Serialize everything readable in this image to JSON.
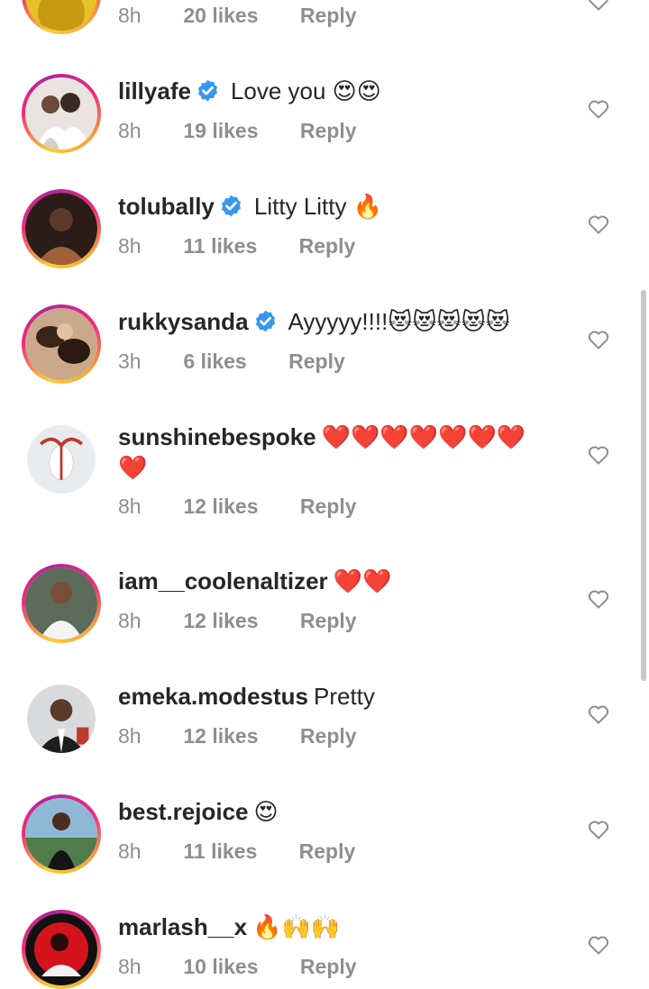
{
  "colors": {
    "text": "#262626",
    "meta": "#8e8e8e",
    "verified": "#3897f0",
    "heart_emoji": "#d62828"
  },
  "top_partial": {
    "time": "8h",
    "likes": "20 likes",
    "reply": "Reply"
  },
  "comments": [
    {
      "username": "lillyafe",
      "verified": true,
      "text": "Love you 😍😍",
      "time": "8h",
      "likes": "19 likes",
      "reply": "Reply"
    },
    {
      "username": "tolubally",
      "verified": true,
      "text": "Litty Litty 🔥",
      "time": "8h",
      "likes": "11 likes",
      "reply": "Reply"
    },
    {
      "username": "rukkysanda",
      "verified": true,
      "text": "Ayyyyy!!!!😻😻😻😻😻",
      "time": "3h",
      "likes": "6 likes",
      "reply": "Reply"
    },
    {
      "username": "sunshinebespoke",
      "verified": false,
      "text": "❤️❤️❤️❤️❤️❤️❤️❤️",
      "time": "8h",
      "likes": "12 likes",
      "reply": "Reply"
    },
    {
      "username": "iam__coolenaltizer",
      "verified": false,
      "text": "❤️❤️",
      "time": "8h",
      "likes": "12 likes",
      "reply": "Reply"
    },
    {
      "username": "emeka.modestus",
      "verified": false,
      "text": "Pretty",
      "time": "8h",
      "likes": "12 likes",
      "reply": "Reply"
    },
    {
      "username": "best.rejoice",
      "verified": false,
      "text": "😍",
      "time": "8h",
      "likes": "11 likes",
      "reply": "Reply"
    },
    {
      "username": "marlash__x",
      "verified": false,
      "text": "🔥🙌🙌",
      "time": "8h",
      "likes": "10 likes",
      "reply": "Reply"
    }
  ]
}
